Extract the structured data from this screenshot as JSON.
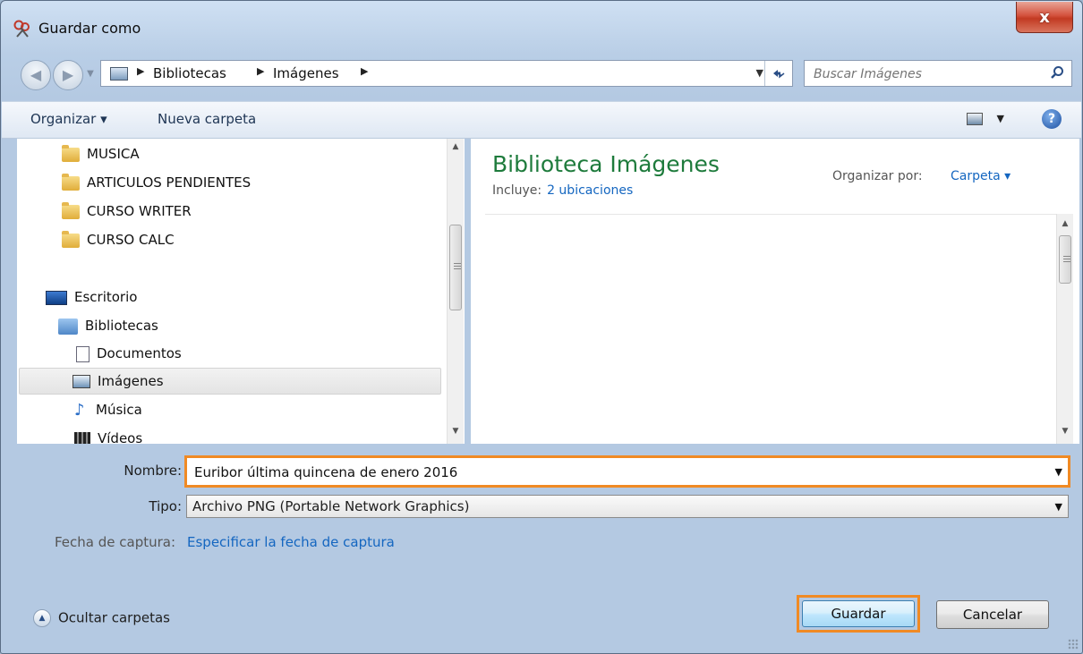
{
  "window": {
    "title": "Guardar como",
    "close_glyph": "x"
  },
  "nav": {
    "breadcrumbs": [
      "Bibliotecas",
      "Imágenes"
    ],
    "search_placeholder": "Buscar Imágenes"
  },
  "toolbar": {
    "organize_label": "Organizar ▾",
    "new_folder_label": "Nueva carpeta",
    "help_glyph": "?"
  },
  "tree": {
    "items": [
      {
        "label": "MUSICA",
        "icon": "folder-icon"
      },
      {
        "label": "ARTICULOS PENDIENTES",
        "icon": "folder-icon"
      },
      {
        "label": "CURSO WRITER",
        "icon": "folder-icon"
      },
      {
        "label": "CURSO CALC",
        "icon": "folder-icon"
      },
      {
        "label": "Escritorio",
        "icon": "desktop-icon"
      },
      {
        "label": "Bibliotecas",
        "icon": "libraries-icon"
      },
      {
        "label": "Documentos",
        "icon": "documents-icon"
      },
      {
        "label": "Imágenes",
        "icon": "pictures-icon",
        "selected": true
      },
      {
        "label": "Música",
        "icon": "music-icon"
      },
      {
        "label": "Vídeos",
        "icon": "videos-icon"
      }
    ]
  },
  "library": {
    "title": "Biblioteca Imágenes",
    "includes_label": "Incluye:",
    "includes_link": "2 ubicaciones",
    "arrange_label": "Organizar por:",
    "arrange_value": "Carpeta ▾"
  },
  "form": {
    "name_label": "Nombre:",
    "name_value": "Euribor última quincena de enero 2016",
    "type_label": "Tipo:",
    "type_value": "Archivo PNG (Portable Network Graphics)",
    "date_label": "Fecha de captura:",
    "date_link": "Especificar la fecha de captura"
  },
  "footer": {
    "hide_folders": "Ocultar carpetas",
    "save": "Guardar",
    "cancel": "Cancelar"
  },
  "colors": {
    "highlight": "#f08a24",
    "link": "#1466c0",
    "library_title": "#1e7b3c"
  }
}
